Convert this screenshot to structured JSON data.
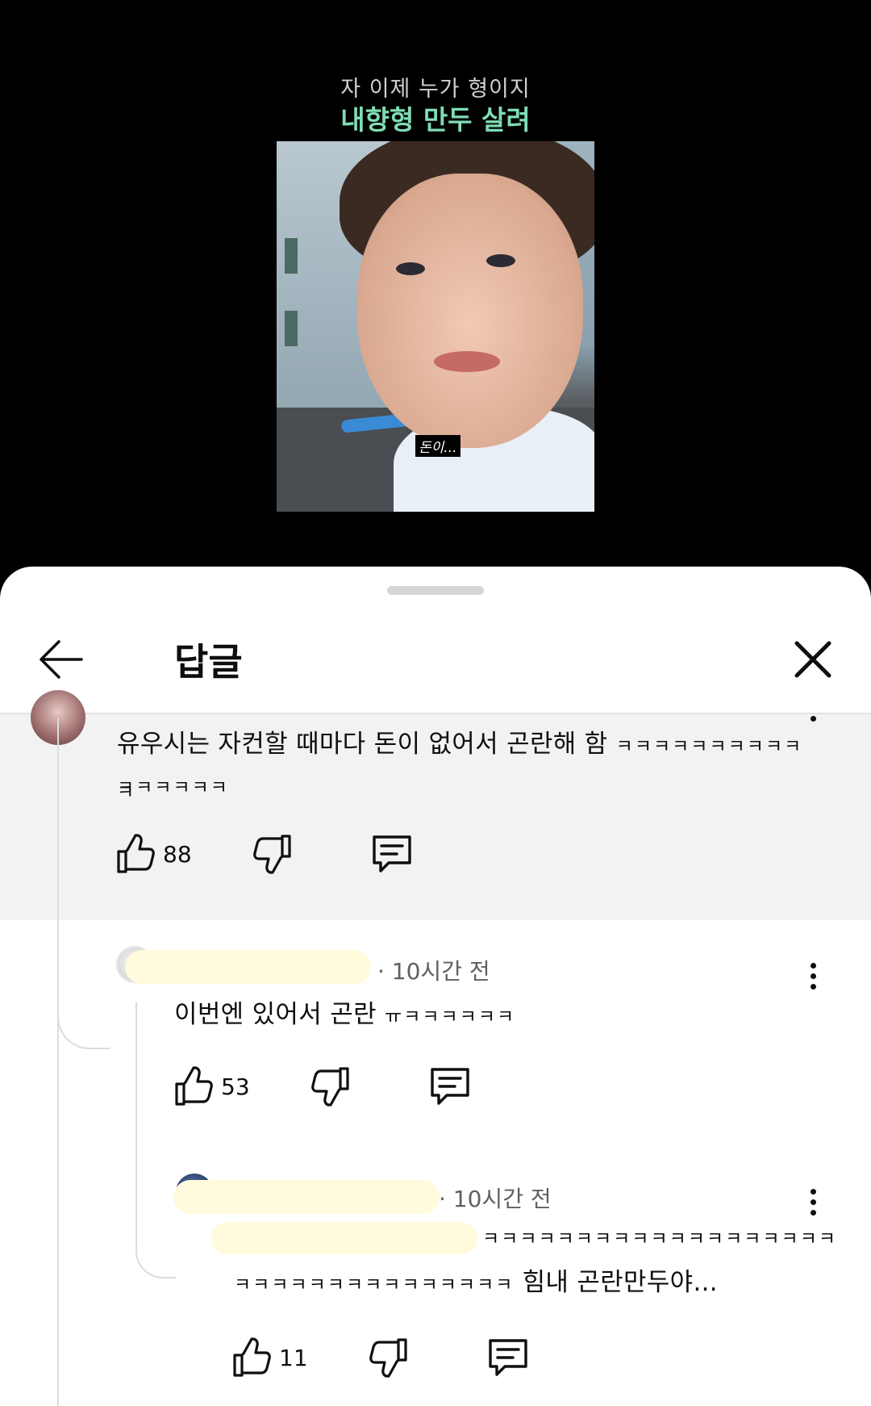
{
  "video": {
    "caption_top": "자 이제 누가 형이지",
    "caption_title": "내향형 만두 살려",
    "subtitle": "돈이..."
  },
  "header": {
    "title": "답글",
    "back_icon": "arrow-left-icon",
    "close_icon": "close-icon"
  },
  "comments": [
    {
      "text": "유우시는 자컨할 때마다 돈이 없어서 곤란해 함",
      "laugh_line1": "ㅋㅋㅋㅋㅋㅋㅋㅋㅋㅋㅋ",
      "laugh_line2": "ㅋㅋㅋㅋㅋㅋ",
      "likes": "88"
    },
    {
      "meta": "· 10시간 전",
      "text": "이번엔 있어서 곤란",
      "laugh": "ㅠㅋㅋㅋㅋㅋㅋ",
      "likes": "53"
    },
    {
      "meta": "· 10시간 전",
      "laugh_line1": "ㅋㅋㅋㅋㅋㅋㅋㅋㅋㅋㅋㅋㅋㅋㅋㅋㅋㅋㅋ",
      "laugh_line2": "ㅋㅋㅋㅋㅋㅋㅋㅋㅋㅋㅋㅋㅋㅋㅋ",
      "text_tail": "힘내 곤란만두야...",
      "likes": "11"
    }
  ],
  "colors": {
    "caption_title": "#7fdcb4",
    "highlight_bg": "#f2f2f2",
    "redaction": "#fffbdc"
  }
}
